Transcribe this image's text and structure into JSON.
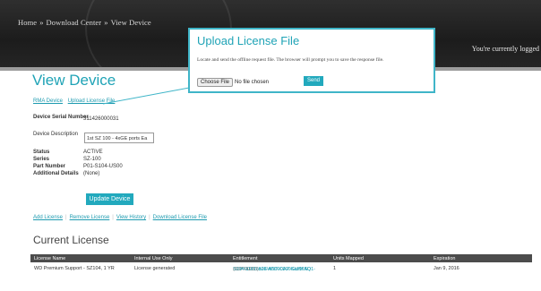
{
  "header": {
    "breadcrumb": [
      "Home",
      "Download Center",
      "View Device"
    ],
    "breadcrumb_sep": "»",
    "logged_text": "You're currently logged"
  },
  "page": {
    "title": "View Device",
    "top_links": [
      "RMA Device",
      "Upload License File"
    ]
  },
  "device": {
    "serial_label": "Device Serial Number",
    "serial_value": "311426000031",
    "description_label": "Device Description",
    "description_value": "1st SZ 100 - 4xGE ports Ea",
    "status_label": "Status",
    "status_value": "ACTIVE",
    "series_label": "Series",
    "series_value": "SZ-100",
    "part_label": "Part Number",
    "part_value": "P01-S104-US00",
    "additional_label": "Additional Details",
    "additional_value": "(None)"
  },
  "update_button": "Update Device",
  "action_links": [
    "Add License",
    "Remove License",
    "View History",
    "Download License File"
  ],
  "license": {
    "section_title": "Current License",
    "columns": [
      "License Name",
      "Internal Use Only",
      "Entitlement",
      "Units Mapped",
      "Expiration"
    ],
    "rows": [
      {
        "name": "WD Premium Support - SZ104, 1 YR",
        "internal": "License generated",
        "entitlement_line1": "SUP-00312828-ANT-CAP-GUM SD1-",
        "entitlement_line2": "S104-1000 a0EW0000010KattMAQ",
        "entitlement_sub": "(8377A233)",
        "units": "1",
        "expiration": "Jan 9, 2016"
      }
    ]
  },
  "popup": {
    "title": "Upload License File",
    "description": "Locate and send the offline request file. The browser will prompt you to save the response file.",
    "choose_label": "Choose File",
    "no_file": "No file chosen",
    "send_label": "Send"
  },
  "colors": {
    "accent": "#1fa3b6",
    "header_bg": "#1c1c1c",
    "table_header_bg": "#4c4c4c"
  }
}
